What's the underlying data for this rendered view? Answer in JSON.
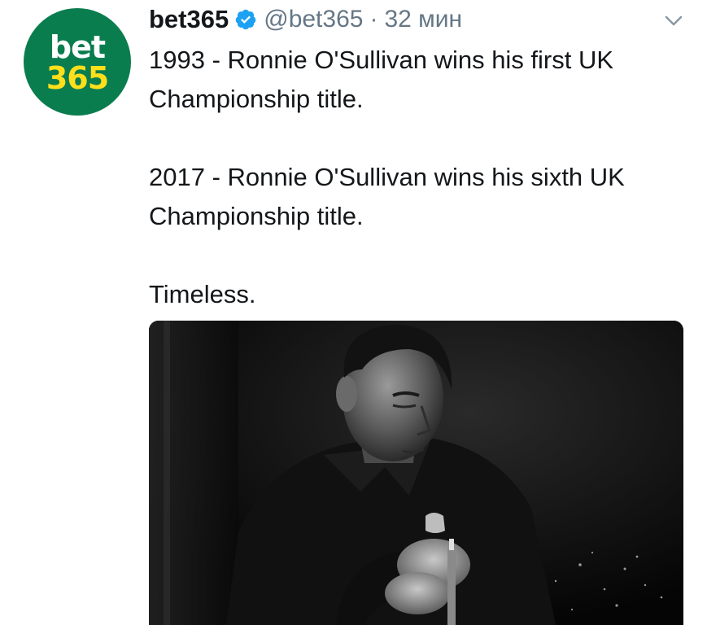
{
  "tweet": {
    "avatar": {
      "line1": "bet",
      "line2": "365",
      "bg_color": "#0a7d4f",
      "line2_color": "#ffdf1b"
    },
    "display_name": "bet365",
    "verified_icon": "verified-badge-icon",
    "handle": "@bet365",
    "separator": "·",
    "time": "32 мин",
    "menu_icon": "chevron-down-icon",
    "text_paragraphs": [
      "1993 - Ronnie O'Sullivan wins his first UK Championship title.",
      "2017 - Ronnie O'Sullivan wins his sixth UK Championship title.",
      "Timeless."
    ],
    "media": {
      "type": "photo",
      "style": "black-and-white"
    },
    "colors": {
      "text": "#14171a",
      "secondary": "#657786",
      "verified": "#1da1f2"
    }
  }
}
